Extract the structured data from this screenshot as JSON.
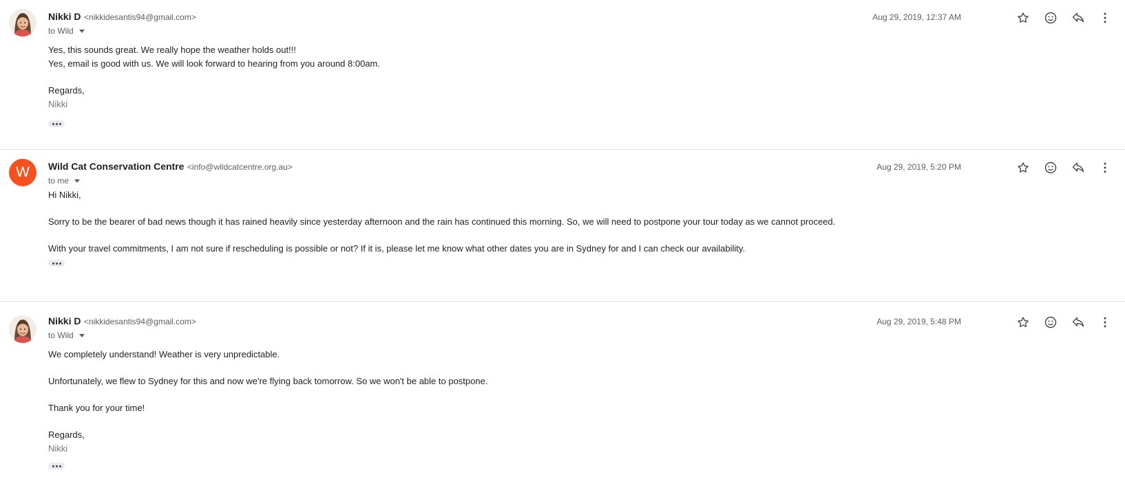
{
  "messages": [
    {
      "sender_name": "Nikki D",
      "sender_email": "<nikkidesantis94@gmail.com>",
      "recipient": "to Wild",
      "timestamp": "Aug 29, 2019, 12:37 AM",
      "avatar_letter": "",
      "lines": {
        "l1": "Yes, this sounds great. We really hope the weather holds out!!!",
        "l2": "Yes, email is good with us. We will look forward to hearing from you around 8:00am.",
        "l3": "Regards,",
        "l4": "Nikki"
      }
    },
    {
      "sender_name": "Wild Cat Conservation Centre",
      "sender_email": "<info@wildcatcentre.org.au>",
      "recipient": "to me",
      "timestamp": "Aug 29, 2019, 5:20 PM",
      "avatar_letter": "W",
      "lines": {
        "l1": "Hi Nikki,",
        "l2": "Sorry to be the bearer of bad news though it has rained heavily since yesterday afternoon and the rain has continued this morning. So, we will need to postpone your tour today as we cannot proceed.",
        "l3": "With your travel commitments, I am not sure if rescheduling is possible or not? If it is, please let me know what other dates you are in Sydney for and I can check our availability."
      }
    },
    {
      "sender_name": "Nikki D",
      "sender_email": "<nikkidesantis94@gmail.com>",
      "recipient": "to Wild",
      "timestamp": "Aug 29, 2019, 5:48 PM",
      "avatar_letter": "",
      "lines": {
        "l1": "We completely understand! Weather is very unpredictable.",
        "l2": "Unfortunately, we flew to Sydney for this and now we're flying back tomorrow. So we won't be able to postpone.",
        "l3": "Thank you for your time!",
        "l4": "Regards,",
        "l5": "Nikki"
      }
    }
  ],
  "icons": {
    "star": "star-icon",
    "emoji": "emoji-icon",
    "reply": "reply-icon",
    "more": "more-vert-icon",
    "ellipsis": "show-trimmed-content-icon"
  },
  "colors": {
    "avatar_w": "#f4511e",
    "divider": "#e4e4e4",
    "meta_text": "#5e5e5e",
    "signature_text": "#777777"
  }
}
